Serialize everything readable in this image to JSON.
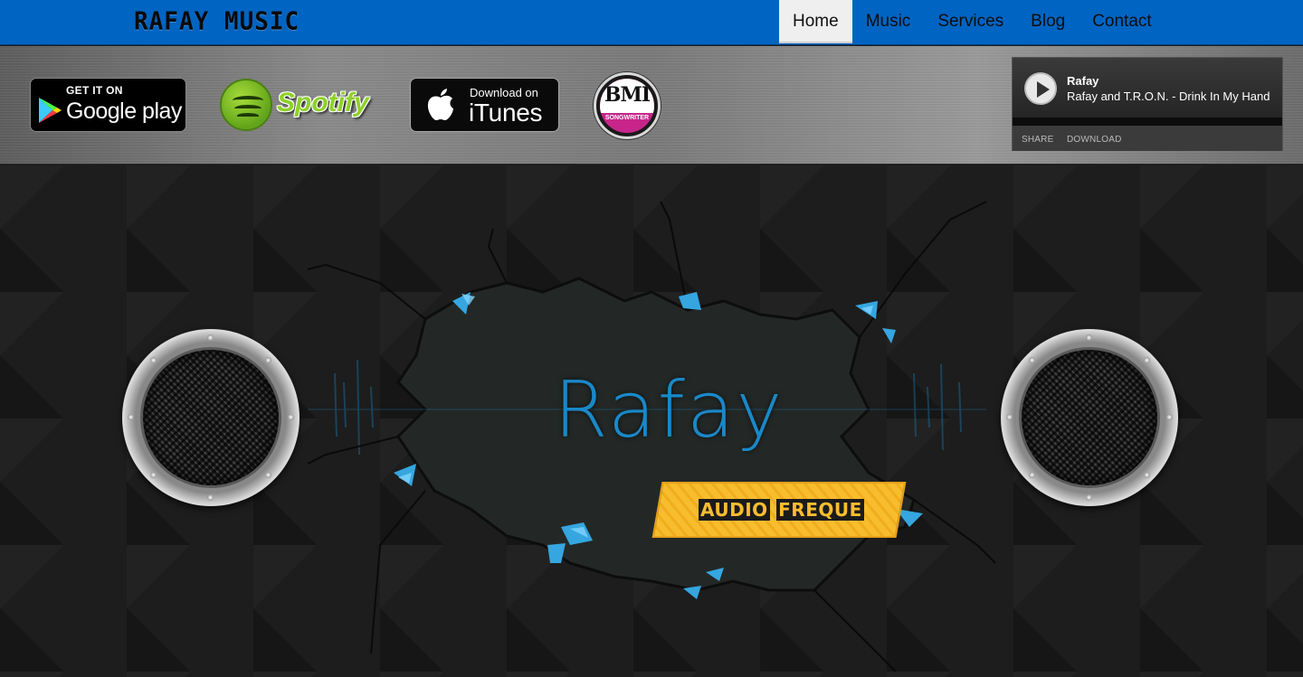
{
  "brand": {
    "title": "RAFAY MUSIC"
  },
  "nav": {
    "items": [
      {
        "label": "Home",
        "active": true
      },
      {
        "label": "Music",
        "active": false
      },
      {
        "label": "Services",
        "active": false
      },
      {
        "label": "Blog",
        "active": false
      },
      {
        "label": "Contact",
        "active": false
      }
    ]
  },
  "badges": {
    "google_play": {
      "small": "GET IT ON",
      "big": "Google play"
    },
    "spotify": {
      "word": "Spotify"
    },
    "itunes": {
      "small": "Download on",
      "big": "iTunes"
    },
    "bmi": {
      "letters": "BMI",
      "sub": "SONGWRITER"
    }
  },
  "player": {
    "artist": "Rafay",
    "track": "Rafay and T.R.O.N. - Drink In My Hand",
    "share_label": "SHARE",
    "download_label": "DOWNLOAD"
  },
  "hero": {
    "title": "Rafay",
    "ribbon_word1": "AUDIO",
    "ribbon_word2": "FREQUE"
  },
  "colors": {
    "nav_bg": "#0064c2",
    "accent_blue": "#1a88c8",
    "ribbon_yellow": "#f8bd2e",
    "spotify_green": "#8fd12a",
    "bmi_pink": "#c8258a"
  }
}
